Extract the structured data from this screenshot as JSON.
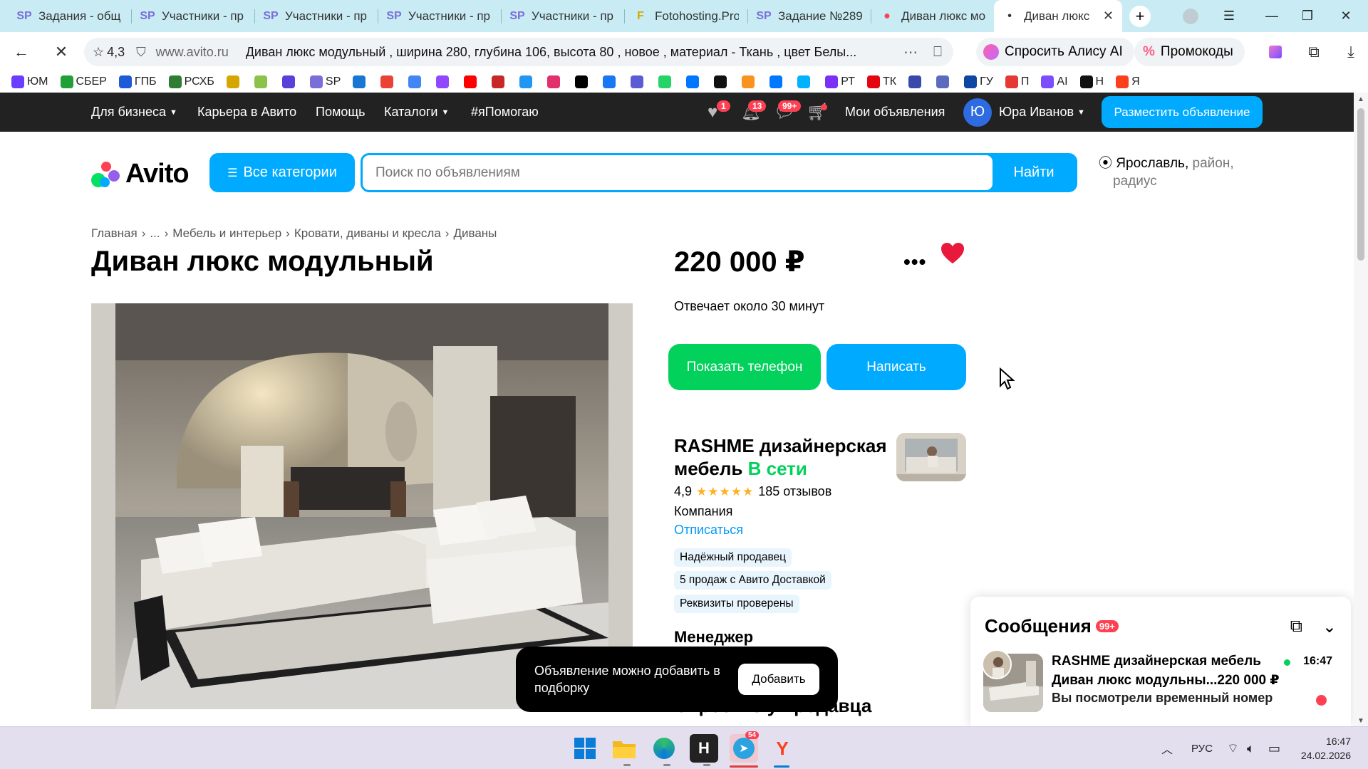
{
  "browser": {
    "tabs": [
      {
        "icon": "SP",
        "title": "Задания - общ",
        "color": "#7a6fd9"
      },
      {
        "icon": "SP",
        "title": "Участники - пр",
        "color": "#7a6fd9"
      },
      {
        "icon": "SP",
        "title": "Участники - пр",
        "color": "#7a6fd9"
      },
      {
        "icon": "SP",
        "title": "Участники - пр",
        "color": "#7a6fd9"
      },
      {
        "icon": "SP",
        "title": "Участники - пр",
        "color": "#7a6fd9"
      },
      {
        "icon": "F",
        "title": "Fotohosting.Pro",
        "color": "#d6a600"
      },
      {
        "icon": "SP",
        "title": "Задание №289",
        "color": "#7a6fd9"
      },
      {
        "icon": "●",
        "title": "Диван люкс мо",
        "color": "#ff4053"
      },
      {
        "icon": "•",
        "title": "Диван люкс",
        "color": "#333"
      }
    ],
    "url_rating": "4,3",
    "domain": "www.avito.ru",
    "page_title": "Диван люкс модульный , ширина 280, глубина 106, высота 80 , новое , материал - Ткань , цвет Белы...",
    "alice_label": "Спросить Алису AI",
    "promo_label": "Промокоды",
    "bookmarks": [
      {
        "label": "ЮМ",
        "color": "#6a3dff"
      },
      {
        "label": "СБЕР",
        "color": "#21a038"
      },
      {
        "label": "ГПБ",
        "color": "#1e5bd8"
      },
      {
        "label": "РСХБ",
        "color": "#2e7d32"
      },
      {
        "label": "",
        "color": "#d6a600"
      },
      {
        "label": "",
        "color": "#8bc34a"
      },
      {
        "label": "",
        "color": "#5b3fd9"
      },
      {
        "label": "SP",
        "color": "#7a6fd9"
      },
      {
        "label": "",
        "color": "#1976d2"
      },
      {
        "label": "",
        "color": "#ea4335"
      },
      {
        "label": "",
        "color": "#4285f4"
      },
      {
        "label": "",
        "color": "#9146ff"
      },
      {
        "label": "",
        "color": "#ff0000"
      },
      {
        "label": "",
        "color": "#c62828"
      },
      {
        "label": "",
        "color": "#2196f3"
      },
      {
        "label": "",
        "color": "#e1306c"
      },
      {
        "label": "",
        "color": "#000000"
      },
      {
        "label": "",
        "color": "#1877f2"
      },
      {
        "label": "",
        "color": "#5b5bd6"
      },
      {
        "label": "",
        "color": "#25d366"
      },
      {
        "label": "",
        "color": "#0077ff"
      },
      {
        "label": "",
        "color": "#111111"
      },
      {
        "label": "",
        "color": "#f7931e"
      },
      {
        "label": "",
        "color": "#0077ff"
      },
      {
        "label": "",
        "color": "#00b2ff"
      },
      {
        "label": "РТ",
        "color": "#7b2ff7"
      },
      {
        "label": "ТК",
        "color": "#e30611"
      },
      {
        "label": "",
        "color": "#3949ab"
      },
      {
        "label": "",
        "color": "#5c6bc0"
      },
      {
        "label": "ГУ",
        "color": "#0d47a1"
      },
      {
        "label": "П",
        "color": "#e53935"
      },
      {
        "label": "AI",
        "color": "#7c4dff"
      },
      {
        "label": "Н",
        "color": "#111111"
      },
      {
        "label": "Я",
        "color": "#fc3f1d"
      }
    ]
  },
  "avito": {
    "topnav": {
      "business": "Для бизнеса",
      "career": "Карьера в Авито",
      "help": "Помощь",
      "catalogs": "Каталоги",
      "ihelp": "#яПомогаю",
      "fav_count": "1",
      "notif_count": "13",
      "msg_count": "99+",
      "my_ads": "Мои объявления",
      "user_initial": "Ю",
      "user_name": "Юра Иванов",
      "post_ad": "Разместить объявление"
    },
    "logo_text": "Avito",
    "all_categories": "Все категории",
    "search_placeholder": "Поиск по объявлениям",
    "search_button": "Найти",
    "location_city": "Ярославль,",
    "location_rest": "район,",
    "location_radius": "радиус",
    "breadcrumbs": [
      "Главная",
      "...",
      "Мебель и интерьер",
      "Кровати, диваны и кресла",
      "Диваны"
    ],
    "title": "Диван люкс модульный",
    "price": "220 000 ₽",
    "responds": "Отвечает около 30 минут",
    "show_phone": "Показать телефон",
    "write": "Написать",
    "seller": {
      "name": "RASHME дизайнерская мебель",
      "online": "В сети",
      "rating": "4,9",
      "stars": "★★★★★",
      "reviews": "185 отзывов",
      "type": "Компания",
      "unsubscribe": "Отписаться",
      "chips": [
        "Надёжный продавец",
        "5 продаж с Авито Доставкой",
        "Реквизиты проверены"
      ],
      "manager": "Менеджер"
    },
    "ask_seller": "Спросите у продавца",
    "toast": {
      "text": "Объявление можно добавить в подборку",
      "button": "Добавить"
    },
    "messages": {
      "title": "Сообщения",
      "badge": "99+",
      "item": {
        "name": "RASHME дизайнерская мебель",
        "time": "16:47",
        "ad": "Диван люкс модульны...220 000 ₽",
        "preview": "Вы посмотрели временный номер"
      }
    }
  },
  "taskbar": {
    "telegram_badge": "54",
    "lang": "РУС",
    "time": "16:47",
    "date": "24.02.2026"
  },
  "colors": {
    "accent": "#00aaff",
    "green": "#02d15c",
    "red": "#ff4053",
    "heart": "#e8193c",
    "dark_nav": "#222222"
  }
}
